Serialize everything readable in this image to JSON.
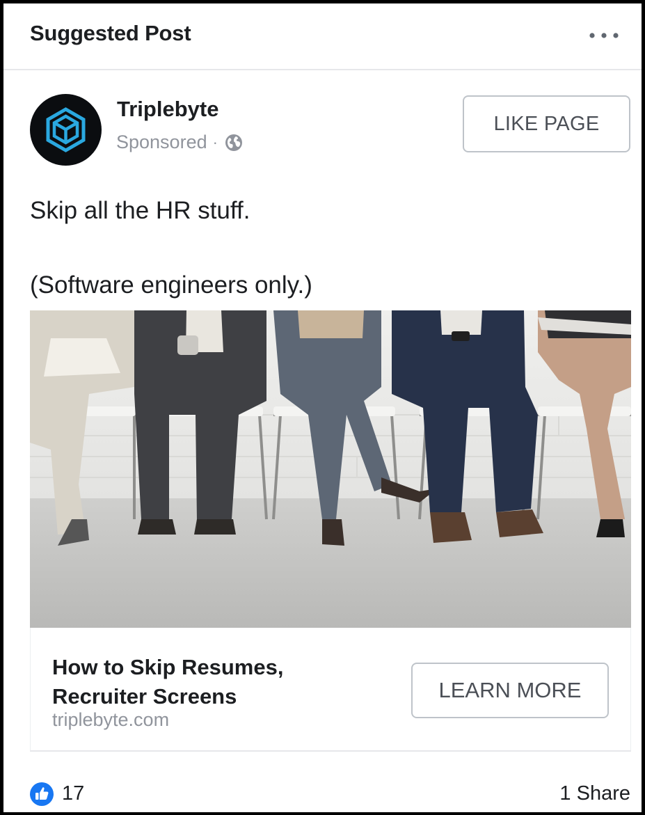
{
  "header": {
    "title": "Suggested Post",
    "more_icon": "more-horizontal-icon"
  },
  "page": {
    "name": "Triplebyte",
    "sponsored_label": "Sponsored",
    "separator": "·",
    "privacy_icon": "globe-icon",
    "logo_icon": "triplebyte-hexagon-logo",
    "like_button_label": "LIKE PAGE"
  },
  "post": {
    "text_line1": "Skip all the HR stuff.",
    "text_line2": "(Software engineers only.)"
  },
  "link_preview": {
    "title": "How to Skip Resumes, Recruiter Screens",
    "domain": "triplebyte.com",
    "cta_label": "LEARN MORE"
  },
  "footer": {
    "reaction_icon": "thumbs-up-icon",
    "like_count": "17",
    "share_count": "1 Share"
  },
  "colors": {
    "brand_blue": "#1877f2",
    "logo_cyan": "#2aa8e0",
    "muted_text": "#90949c"
  }
}
